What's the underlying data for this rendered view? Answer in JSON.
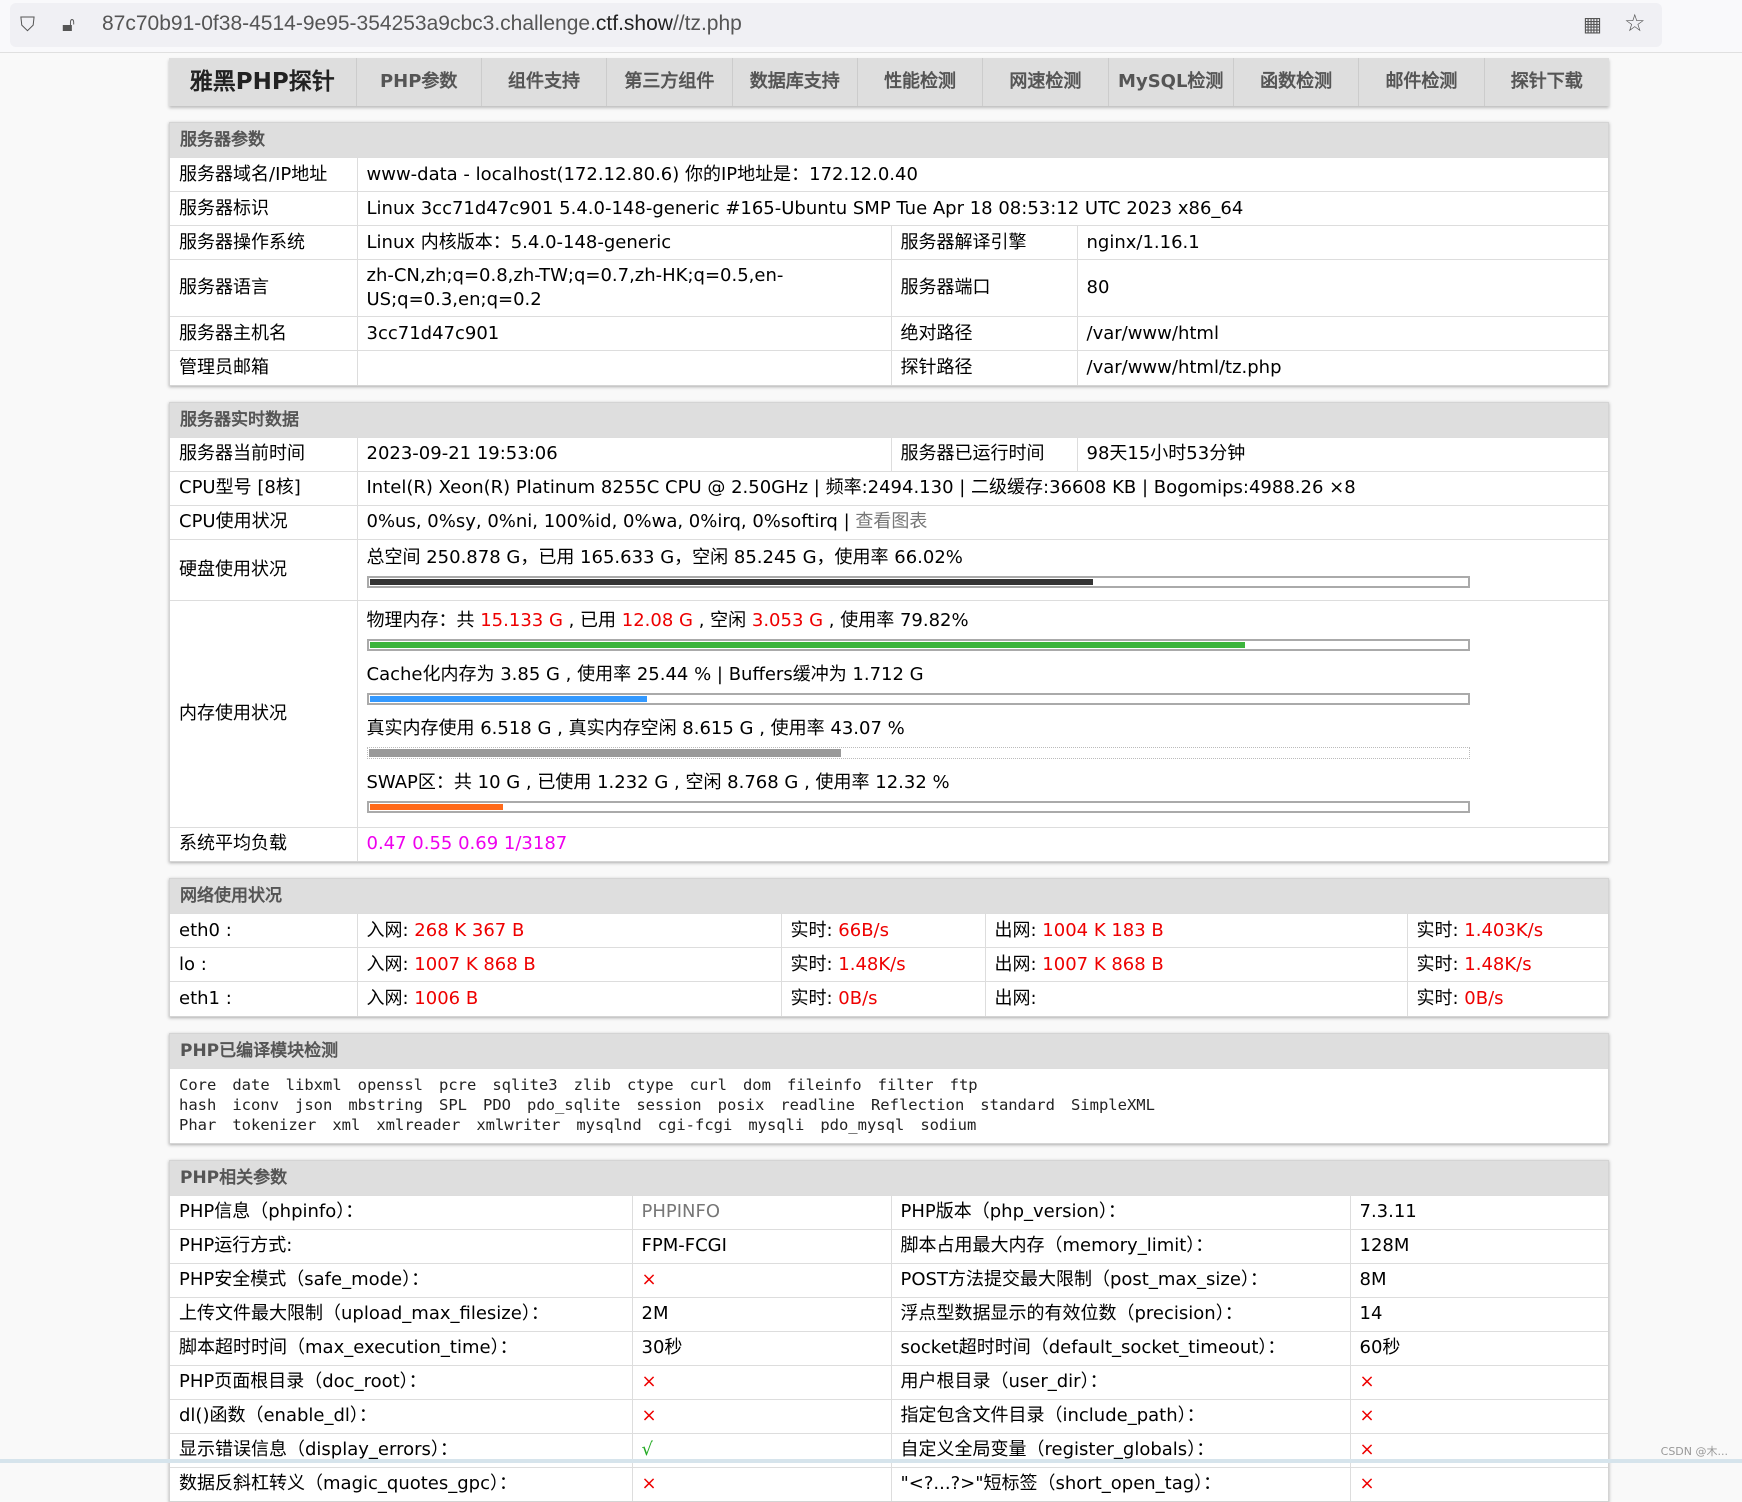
{
  "browser": {
    "url_prefix": "87c70b91-0f38-4514-9e95-354253a9cbc3.challenge.",
    "url_host": "ctf.show",
    "url_path": "//tz.php"
  },
  "nav": {
    "brand": "雅黑PHP探针",
    "items": [
      "PHP参数",
      "组件支持",
      "第三方组件",
      "数据库支持",
      "性能检测",
      "网速检测",
      "MySQL检测",
      "函数检测",
      "邮件检测",
      "探针下载"
    ]
  },
  "server": {
    "title": "服务器参数",
    "rows": [
      [
        "服务器域名/IP地址",
        "www-data - localhost(172.12.80.6)  你的IP地址是：172.12.0.40"
      ],
      [
        "服务器标识",
        "Linux 3cc71d47c901 5.4.0-148-generic #165-Ubuntu SMP Tue Apr 18 08:53:12 UTC 2023 x86_64"
      ],
      [
        "服务器操作系统",
        "Linux  内核版本：5.4.0-148-generic",
        "服务器解译引擎",
        "nginx/1.16.1"
      ],
      [
        "服务器语言",
        "zh-CN,zh;q=0.8,zh-TW;q=0.7,zh-HK;q=0.5,en-US;q=0.3,en;q=0.2",
        "服务器端口",
        "80"
      ],
      [
        "服务器主机名",
        "3cc71d47c901",
        "绝对路径",
        "/var/www/html"
      ],
      [
        "管理员邮箱",
        "",
        "探针路径",
        "/var/www/html/tz.php"
      ]
    ]
  },
  "realtime": {
    "title": "服务器实时数据",
    "time_label": "服务器当前时间",
    "time": "2023-09-21 19:53:06",
    "uptime_label": "服务器已运行时间",
    "uptime": "98天15小时53分钟",
    "cpu_label": "CPU型号 [8核]",
    "cpu": "Intel(R) Xeon(R) Platinum 8255C CPU @ 2.50GHz | 频率:2494.130 | 二级缓存:36608 KB | Bogomips:4988.26 ×8",
    "cpu_use_label": "CPU使用状况",
    "cpu_use": "0%us, 0%sy, 0%ni, 100%id, 0%wa, 0%irq, 0%softirq | ",
    "cpu_chart_link": "查看图表",
    "disk_label": "硬盘使用状况",
    "disk": "总空间 250.878 G，已用 165.633 G，空闲 85.245 G，使用率 66.02%",
    "disk_pct": 66.02,
    "mem_label": "内存使用状况",
    "mem": {
      "p1": "物理内存：共 ",
      "total": "15.133 G",
      "p2": " , 已用 ",
      "used": "12.08 G",
      "p3": " , 空闲 ",
      "free": "3.053 G",
      "p4": " , 使用率 79.82%",
      "pct": 79.82
    },
    "cache": "Cache化内存为 3.85 G , 使用率 25.44 % | Buffers缓冲为 1.712 G",
    "cache_pct": 25.44,
    "real": "真实内存使用 6.518 G , 真实内存空闲 8.615 G , 使用率 43.07 %",
    "real_pct": 43.07,
    "swap": "SWAP区：共 10 G , 已使用 1.232 G , 空闲 8.768 G , 使用率 12.32 %",
    "swap_pct": 12.32,
    "load_label": "系统平均负载",
    "load": "0.47 0.55 0.69 1/3187",
    "colors": {
      "disk": "#333333",
      "mem": "#3cb43c",
      "cache": "#3399ff",
      "real": "#999999",
      "swap": "#ff6a1a"
    }
  },
  "network": {
    "title": "网络使用状况",
    "rows": [
      {
        "name": "eth0 :",
        "in": "268 K 367 B",
        "in_rt": "66B/s",
        "out": "1004 K 183 B",
        "out_rt": "1.403K/s"
      },
      {
        "name": "lo :",
        "in": "1007 K 868 B",
        "in_rt": "1.48K/s",
        "out": "1007 K 868 B",
        "out_rt": "1.48K/s"
      },
      {
        "name": "eth1 :",
        "in": "1006 B",
        "in_rt": "0B/s",
        "out": "",
        "out_rt": "0B/s"
      }
    ],
    "in_label": "入网: ",
    "rt_label": "实时: ",
    "out_label": "出网: "
  },
  "modules": {
    "title": "PHP已编译模块检测",
    "lines": [
      [
        "Core",
        "date",
        "libxml",
        "openssl",
        "pcre",
        "sqlite3",
        "zlib",
        "ctype",
        "curl",
        "dom",
        "fileinfo",
        "filter",
        "ftp"
      ],
      [
        "hash",
        "iconv",
        "json",
        "mbstring",
        "SPL",
        "PDO",
        "pdo_sqlite",
        "session",
        "posix",
        "readline",
        "Reflection",
        "standard",
        "SimpleXML"
      ],
      [
        "Phar",
        "tokenizer",
        "xml",
        "xmlreader",
        "xmlwriter",
        "mysqlnd",
        "cgi-fcgi",
        "mysqli",
        "pdo_mysql",
        "sodium"
      ]
    ]
  },
  "php": {
    "title": "PHP相关参数",
    "rows": [
      [
        "PHP信息（phpinfo）：",
        "PHPINFO",
        "PHP版本（php_version）：",
        "7.3.11"
      ],
      [
        "PHP运行方式:",
        "FPM-FCGI",
        "脚本占用最大内存（memory_limit）：",
        "128M"
      ],
      [
        "PHP安全模式（safe_mode）：",
        "×",
        "POST方法提交最大限制（post_max_size）：",
        "8M"
      ],
      [
        "上传文件最大限制（upload_max_filesize）：",
        "2M",
        "浮点型数据显示的有效位数（precision）：",
        "14"
      ],
      [
        "脚本超时时间（max_execution_time）：",
        "30秒",
        "socket超时时间（default_socket_timeout）：",
        "60秒"
      ],
      [
        "PHP页面根目录（doc_root）：",
        "×",
        "用户根目录（user_dir）：",
        "×"
      ],
      [
        "dl()函数（enable_dl）：",
        "×",
        "指定包含文件目录（include_path）：",
        "×"
      ],
      [
        "显示错误信息（display_errors）：",
        "√",
        "自定义全局变量（register_globals）：",
        "×"
      ],
      [
        "数据反斜杠转义（magic_quotes_gpc）：",
        "×",
        "\"<?...?>\"短标签（short_open_tag）：",
        "×"
      ]
    ]
  },
  "watermark": "CSDN @木..."
}
